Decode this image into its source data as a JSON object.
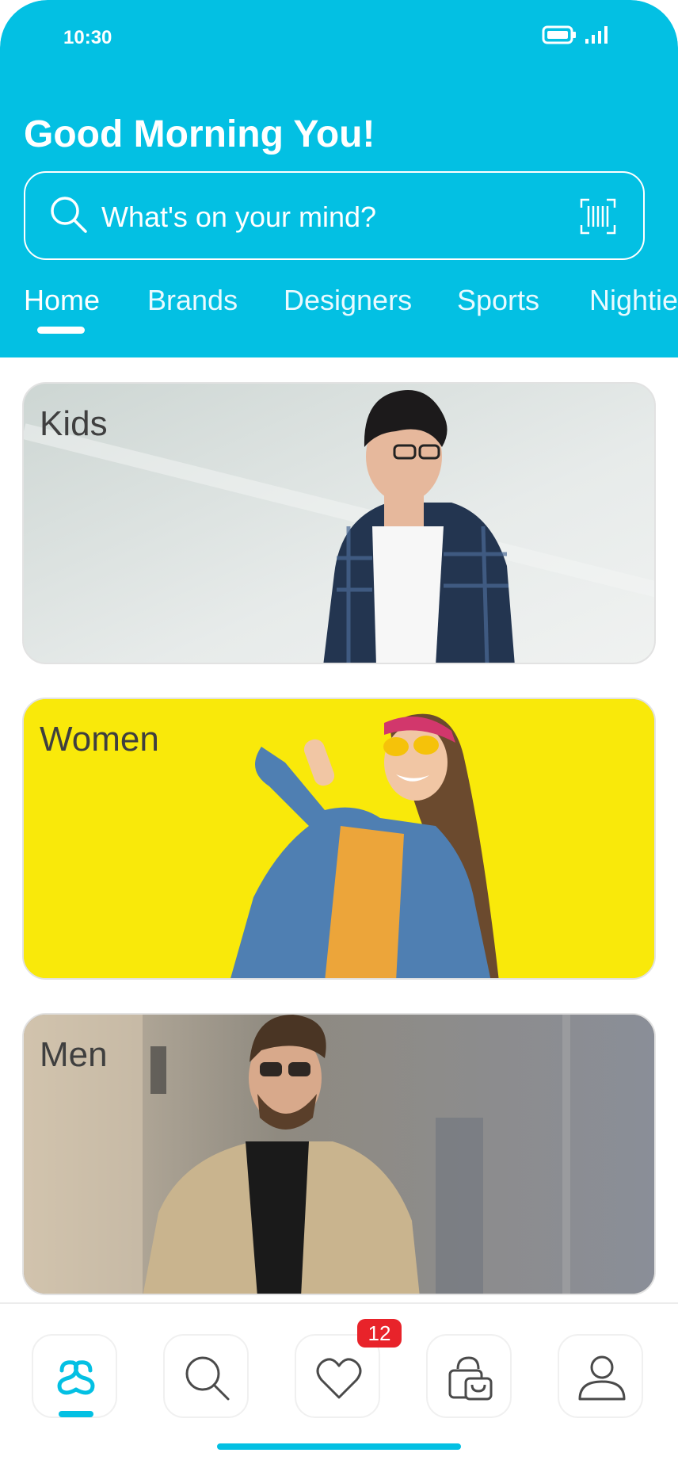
{
  "status_bar": {
    "time": "10:30"
  },
  "header": {
    "greeting": "Good Morning You!",
    "search_placeholder": "What's on your mind?"
  },
  "tabs": [
    {
      "label": "Home",
      "selected": true
    },
    {
      "label": "Brands",
      "selected": false
    },
    {
      "label": "Designers",
      "selected": false
    },
    {
      "label": "Sports",
      "selected": false
    },
    {
      "label": "Nightie",
      "selected": false
    }
  ],
  "categories": [
    {
      "label": "Kids",
      "background": "#dfe4e2"
    },
    {
      "label": "Women",
      "background": "#f9e90a"
    },
    {
      "label": "Men",
      "background": "#9a9387"
    }
  ],
  "bottom_nav": {
    "items": [
      {
        "icon": "brand-logo-icon",
        "active": true
      },
      {
        "icon": "search-icon",
        "active": false
      },
      {
        "icon": "heart-icon",
        "active": false
      },
      {
        "icon": "shopping-bag-icon",
        "active": false
      },
      {
        "icon": "profile-icon",
        "active": false
      }
    ],
    "wishlist_badge": "12"
  },
  "colors": {
    "accent": "#03c0e3",
    "badge": "#e8232a",
    "text_dark": "#3f3f3f"
  }
}
